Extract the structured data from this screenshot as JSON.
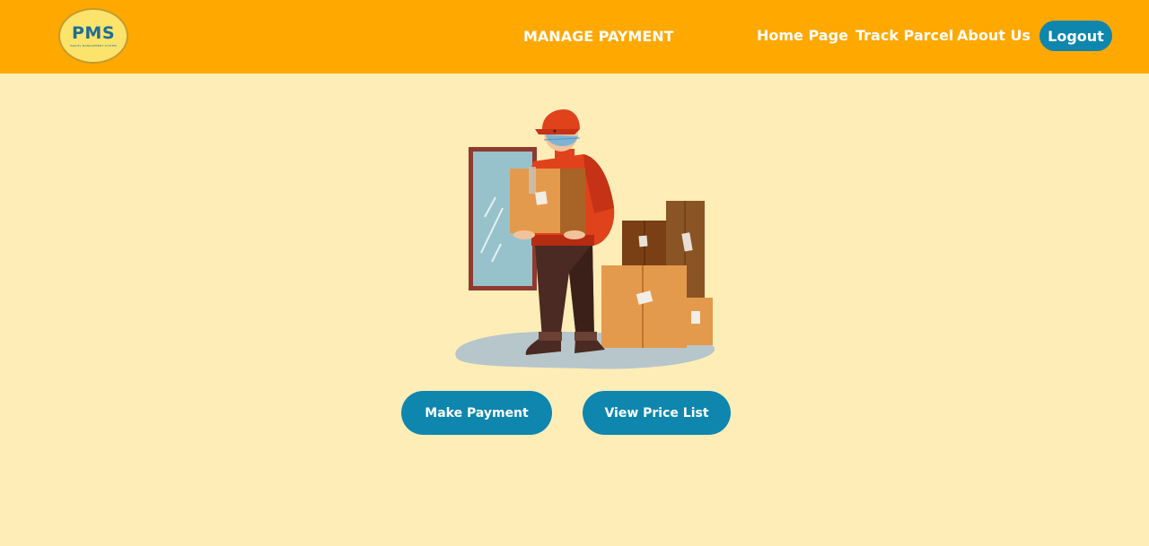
{
  "logo": {
    "text": "PMS",
    "subtitle": "PARCEL MANAGEMENT SYSTEM"
  },
  "header": {
    "title": "MANAGE PAYMENT"
  },
  "nav": {
    "home": "Home Page",
    "track": "Track Parcel",
    "about": "About Us",
    "logout": "Logout"
  },
  "actions": {
    "make_payment": "Make Payment",
    "view_price_list": "View Price List"
  },
  "colors": {
    "header_bg": "#FFA800",
    "page_bg": "#FFEDB8",
    "button_bg": "#0E86AE",
    "text_light": "#FFFFFF"
  },
  "illustration": {
    "subject": "delivery-person-with-boxes"
  }
}
